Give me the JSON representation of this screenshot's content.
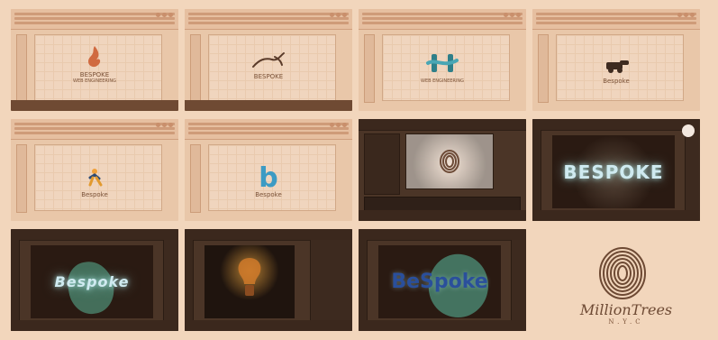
{
  "tiles": [
    {
      "id": "tile-1",
      "kind": "web-logo",
      "logo_text": "BESPOKE",
      "logo_subtext": "WEB ENGINEERING"
    },
    {
      "id": "tile-2",
      "kind": "web-logo",
      "logo_text": "BESPOKE",
      "logo_subtext": ""
    },
    {
      "id": "tile-3",
      "kind": "web-logo",
      "logo_text": "",
      "logo_subtext": "WEB ENGINEERING"
    },
    {
      "id": "tile-4",
      "kind": "web-logo",
      "logo_text": "Bespoke",
      "logo_subtext": ""
    },
    {
      "id": "tile-5",
      "kind": "web-logo",
      "logo_text": "Bespoke",
      "logo_subtext": ""
    },
    {
      "id": "tile-6",
      "kind": "web-logo",
      "logo_text": "Bespoke",
      "logo_subtext": ""
    },
    {
      "id": "tile-7",
      "kind": "video-editor",
      "logo_text": "",
      "logo_subtext": ""
    },
    {
      "id": "tile-8",
      "kind": "photoshop",
      "logo_text": "BESPOKE",
      "logo_subtext": ""
    },
    {
      "id": "tile-9",
      "kind": "photoshop",
      "logo_text": "Bespoke",
      "logo_subtext": ""
    },
    {
      "id": "tile-10",
      "kind": "photoshop",
      "logo_text": "",
      "logo_subtext": ""
    },
    {
      "id": "tile-11",
      "kind": "photoshop",
      "logo_text": "BeSpoke",
      "logo_subtext": ""
    }
  ],
  "brand": {
    "signature": "MillionTrees",
    "location": "N.Y.C"
  }
}
